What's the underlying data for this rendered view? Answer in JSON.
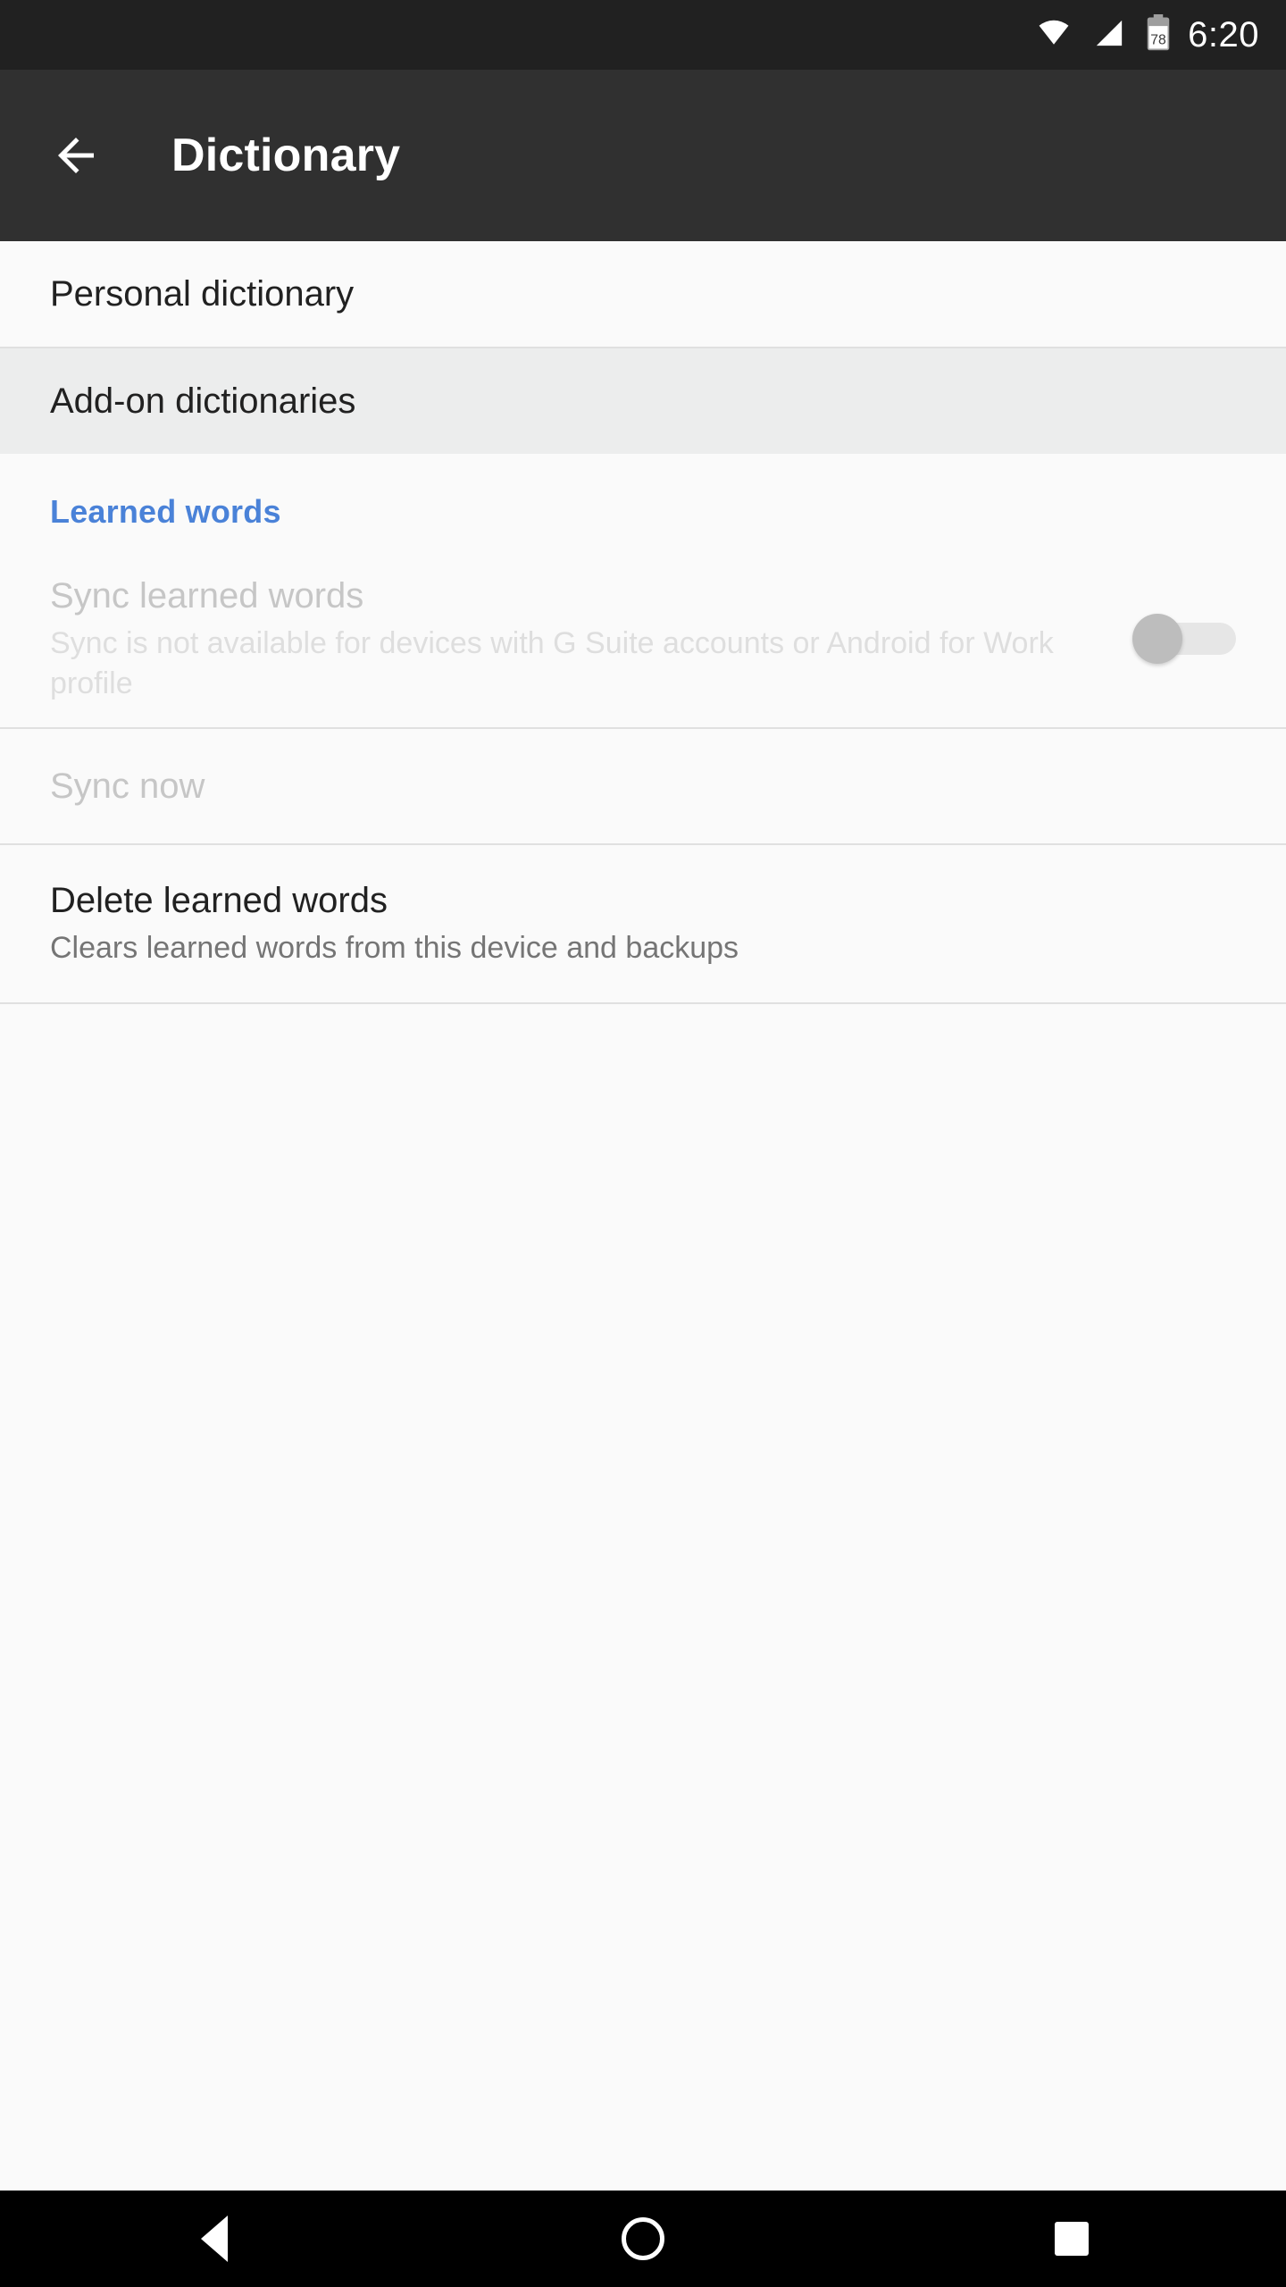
{
  "status_bar": {
    "wifi_icon": "wifi-icon",
    "signal_icon": "cellular-signal-icon",
    "battery_icon": "battery-icon",
    "battery_level": "78",
    "time": "6:20",
    "background_color": "#212121"
  },
  "app_bar": {
    "back_icon": "back-arrow-icon",
    "title": "Dictionary",
    "background_color": "#303030"
  },
  "settings": {
    "items": [
      {
        "key": "personal_dictionary",
        "title": "Personal dictionary",
        "summary": "",
        "enabled": true,
        "highlighted": false
      },
      {
        "key": "add_on_dictionaries",
        "title": "Add-on dictionaries",
        "summary": "",
        "enabled": true,
        "highlighted": true
      }
    ],
    "section": {
      "title": "Learned words",
      "color": "#4a82d8"
    },
    "learned_words_items": [
      {
        "key": "sync_learned_words",
        "title": "Sync learned words",
        "summary": "Sync is not available for devices with G Suite accounts or Android for Work profile",
        "enabled": false,
        "toggle_state": "off"
      },
      {
        "key": "sync_now",
        "title": "Sync now",
        "summary": "",
        "enabled": false
      },
      {
        "key": "delete_learned_words",
        "title": "Delete learned words",
        "summary": "Clears learned words from this device and backups",
        "enabled": true
      }
    ]
  },
  "nav_bar": {
    "back_icon": "nav-back-icon",
    "home_icon": "nav-home-icon",
    "recents_icon": "nav-recents-icon",
    "background_color": "#000000"
  }
}
